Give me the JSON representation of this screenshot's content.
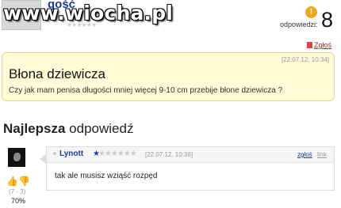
{
  "watermark": "www.wiocha.pl",
  "asker": {
    "name": "gość",
    "stars": "★★★★★★"
  },
  "answers_count": {
    "label": "odpowiedzi:",
    "value": "8",
    "icon": "exclamation-icon"
  },
  "report_top": "Zgłoś",
  "question": {
    "date": "[22.07.12, 10:34]",
    "title": "Błona dziewicza",
    "body": "Czy jak mam penisa długości mniej więcej 9-10 cm przebije błone dziewicza ?"
  },
  "best": {
    "heading_bold": "Najlepsza",
    "heading_rest": " odpowiedź"
  },
  "answer": {
    "author": "Lynott",
    "rank_icon": "★",
    "stars": "★★★★★★",
    "date": "[22.07.12, 10:36]",
    "report": "zgłoś",
    "link": "link",
    "text": "tak ale musisz wziąść rozpęd"
  },
  "votes": {
    "up_icon": "👍",
    "down_icon": "👎",
    "counts": "(7 - 3)",
    "percent": "70%"
  },
  "colors": {
    "question_bg": "#fefbd6",
    "link_blue": "#1a3b9c",
    "answers_badge": "#f2a818"
  }
}
